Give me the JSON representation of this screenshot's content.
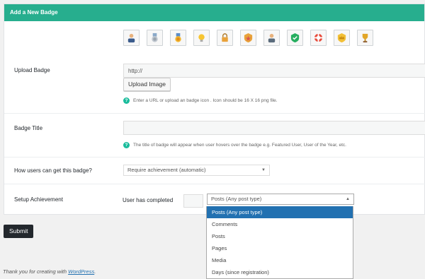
{
  "header": {
    "title": "Add a New Badge"
  },
  "badge_icons": [
    "user-icon",
    "medal-icon",
    "award-icon",
    "bulb-icon",
    "lock-icon",
    "shield-star-icon",
    "person-icon",
    "shield-check-icon",
    "lifebuoy-icon",
    "crown-shield-icon",
    "trophy-icon"
  ],
  "upload": {
    "label": "Upload Badge",
    "value": "http://",
    "button_label": "Upload Image",
    "help": "Enter a URL or upload an badge icon . Icon should be 16 X 16 png file."
  },
  "title_field": {
    "label": "Badge Title",
    "value": "",
    "help": "The title of badge will appear when user hovers over the badge e.g. Featured User, User of the Year, etc."
  },
  "how": {
    "label": "How users can get this badge?",
    "selected": "Require achievement (automatic)"
  },
  "achievement": {
    "label": "Setup Achievement",
    "prefix": "User has completed",
    "count": "",
    "selected": "Posts (Any post type)",
    "options": [
      "Posts (Any post type)",
      "Comments",
      "Posts",
      "Pages",
      "Media",
      "Days (since registration)"
    ]
  },
  "submit_label": "Submit",
  "footer": {
    "text": "Thank you for creating with ",
    "link": "WordPress",
    "suffix": "."
  },
  "colors": {
    "header": "#27ae8e",
    "help_icon": "#1abc9c",
    "selected_option": "#2271b1",
    "submit": "#23282d"
  }
}
